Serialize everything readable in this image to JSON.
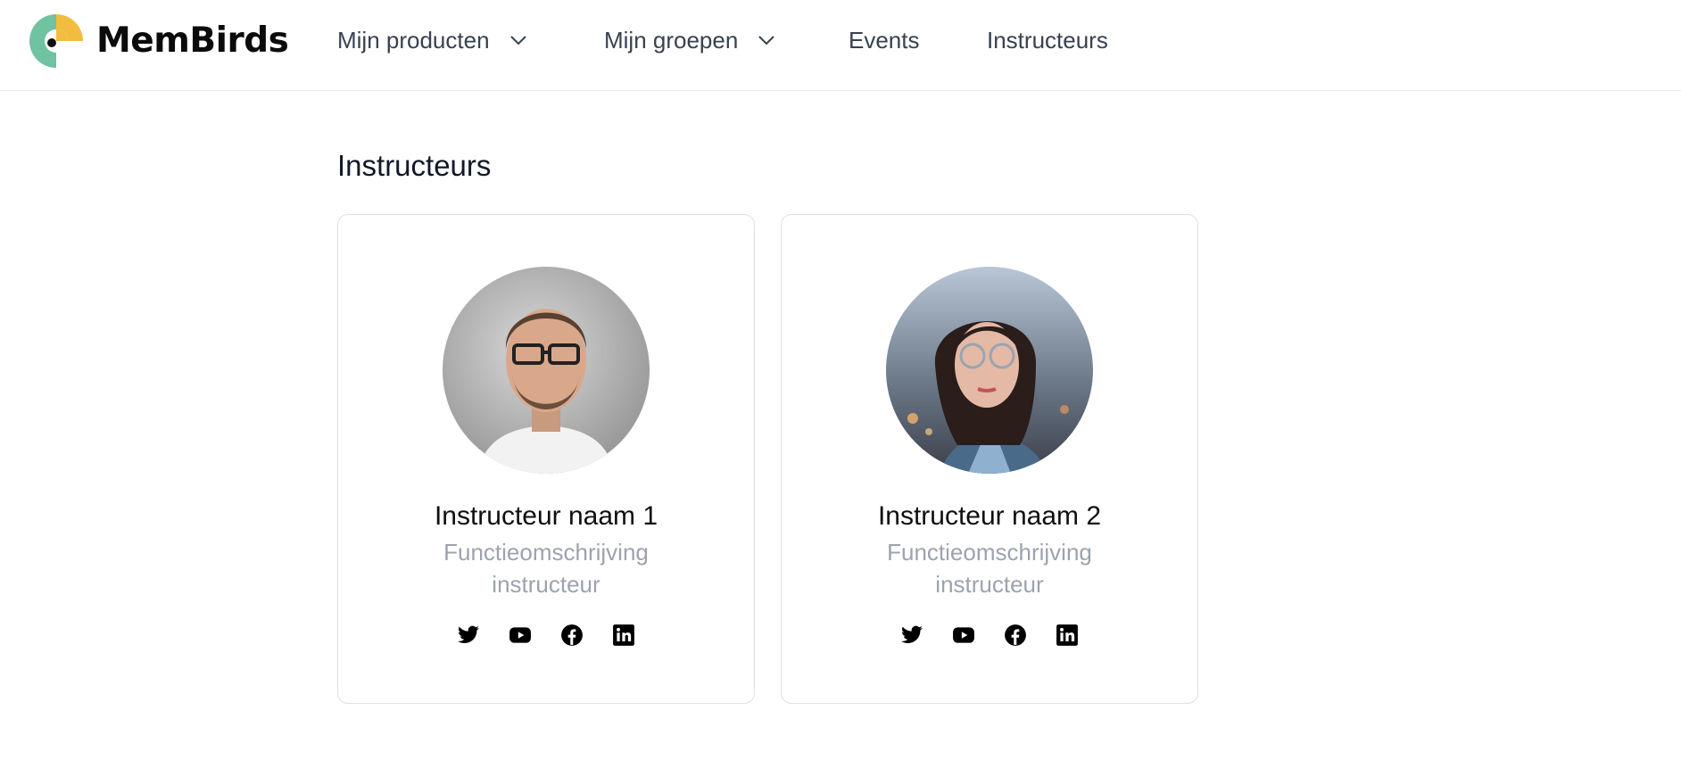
{
  "header": {
    "brand": "MemBirds",
    "nav": [
      {
        "label": "Mijn producten",
        "has_dropdown": true
      },
      {
        "label": "Mijn groepen",
        "has_dropdown": true
      },
      {
        "label": "Events",
        "has_dropdown": false
      },
      {
        "label": "Instructeurs",
        "has_dropdown": false
      }
    ]
  },
  "main": {
    "title": "Instructeurs",
    "instructors": [
      {
        "name": "Instructeur naam 1",
        "role_line1": "Functieomschrijving",
        "role_line2": "instructeur",
        "socials": [
          "twitter-icon",
          "youtube-icon",
          "facebook-icon",
          "linkedin-icon"
        ]
      },
      {
        "name": "Instructeur naam 2",
        "role_line1": "Functieomschrijving",
        "role_line2": "instructeur",
        "socials": [
          "twitter-icon",
          "youtube-icon",
          "facebook-icon",
          "linkedin-icon"
        ]
      }
    ]
  },
  "colors": {
    "logo_green": "#6fc3a0",
    "logo_yellow": "#f2bd3f",
    "nav_text": "#374151",
    "role_text": "#9ca3af",
    "card_border": "#dcdfe4"
  }
}
